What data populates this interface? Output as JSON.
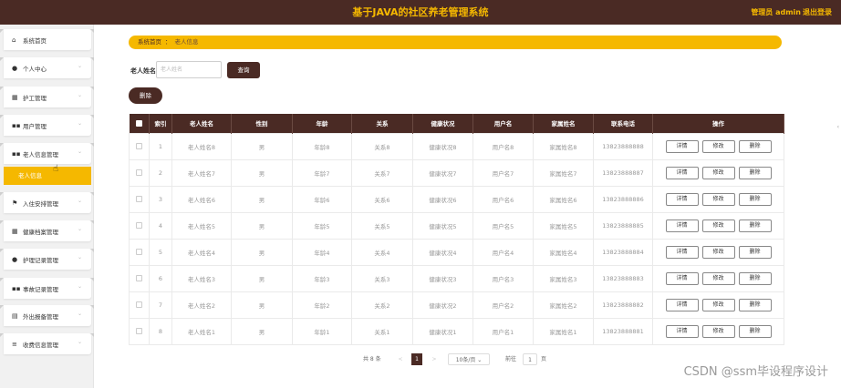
{
  "header": {
    "title": "基于JAVA的社区养老管理系统",
    "user": "管理员 admin",
    "logout": "退出登录"
  },
  "sidebar": {
    "items": [
      {
        "label": "系统首页",
        "icon": "home-icon",
        "glyph": "⌂"
      },
      {
        "label": "个人中心",
        "icon": "user-icon",
        "glyph": "●"
      },
      {
        "label": "护工管理",
        "icon": "briefcase-icon",
        "glyph": "▦"
      },
      {
        "label": "用户管理",
        "icon": "grid-icon",
        "glyph": "▪▪"
      },
      {
        "label": "老人信息管理",
        "icon": "grid-icon",
        "glyph": "▪▪"
      },
      {
        "label": "入住安排管理",
        "icon": "flag-icon",
        "glyph": "⚑"
      },
      {
        "label": "健康档案管理",
        "icon": "table-icon",
        "glyph": "▦"
      },
      {
        "label": "护理记录管理",
        "icon": "user-icon",
        "glyph": "●"
      },
      {
        "label": "事故记录管理",
        "icon": "grid-icon",
        "glyph": "▪▪"
      },
      {
        "label": "外出报备管理",
        "icon": "document-icon",
        "glyph": "▤"
      },
      {
        "label": "收费信息管理",
        "icon": "sliders-icon",
        "glyph": "≡"
      }
    ],
    "sub_item": "老人信息"
  },
  "breadcrumb": {
    "home": "系统首页",
    "separator": "：",
    "current": "老人信息"
  },
  "search": {
    "label": "老人姓名",
    "placeholder": "老人姓名",
    "button": "查询"
  },
  "actions": {
    "delete": "删除"
  },
  "table": {
    "columns": [
      "索引",
      "老人姓名",
      "性别",
      "年龄",
      "关系",
      "健康状况",
      "用户名",
      "家属姓名",
      "联系电话",
      "操作"
    ],
    "row_actions": [
      "详情",
      "修改",
      "删除"
    ],
    "rows": [
      {
        "index": "1",
        "name": "老人姓名8",
        "gender": "男",
        "age": "年龄8",
        "relation": "关系8",
        "health": "健康状况8",
        "username": "用户名8",
        "family": "家属姓名8",
        "phone": "13823888888"
      },
      {
        "index": "2",
        "name": "老人姓名7",
        "gender": "男",
        "age": "年龄7",
        "relation": "关系7",
        "health": "健康状况7",
        "username": "用户名7",
        "family": "家属姓名7",
        "phone": "13823888887"
      },
      {
        "index": "3",
        "name": "老人姓名6",
        "gender": "男",
        "age": "年龄6",
        "relation": "关系6",
        "health": "健康状况6",
        "username": "用户名6",
        "family": "家属姓名6",
        "phone": "13823888886"
      },
      {
        "index": "4",
        "name": "老人姓名5",
        "gender": "男",
        "age": "年龄5",
        "relation": "关系5",
        "health": "健康状况5",
        "username": "用户名5",
        "family": "家属姓名5",
        "phone": "13823888885"
      },
      {
        "index": "5",
        "name": "老人姓名4",
        "gender": "男",
        "age": "年龄4",
        "relation": "关系4",
        "health": "健康状况4",
        "username": "用户名4",
        "family": "家属姓名4",
        "phone": "13823888884"
      },
      {
        "index": "6",
        "name": "老人姓名3",
        "gender": "男",
        "age": "年龄3",
        "relation": "关系3",
        "health": "健康状况3",
        "username": "用户名3",
        "family": "家属姓名3",
        "phone": "13823888883"
      },
      {
        "index": "7",
        "name": "老人姓名2",
        "gender": "男",
        "age": "年龄2",
        "relation": "关系2",
        "health": "健康状况2",
        "username": "用户名2",
        "family": "家属姓名2",
        "phone": "13823888882"
      },
      {
        "index": "8",
        "name": "老人姓名1",
        "gender": "男",
        "age": "年龄1",
        "relation": "关系1",
        "health": "健康状况1",
        "username": "用户名1",
        "family": "家属姓名1",
        "phone": "13823888881"
      }
    ]
  },
  "pagination": {
    "total": "共 8 条",
    "prev": "<",
    "current_page": "1",
    "next": ">",
    "page_size": "10条/页",
    "goto_label": "前往",
    "goto_value": "1",
    "page_suffix": "页"
  },
  "watermark": "CSDN @ssm毕设程序设计",
  "colors": {
    "primary": "#4a2a24",
    "accent": "#f5b800"
  }
}
